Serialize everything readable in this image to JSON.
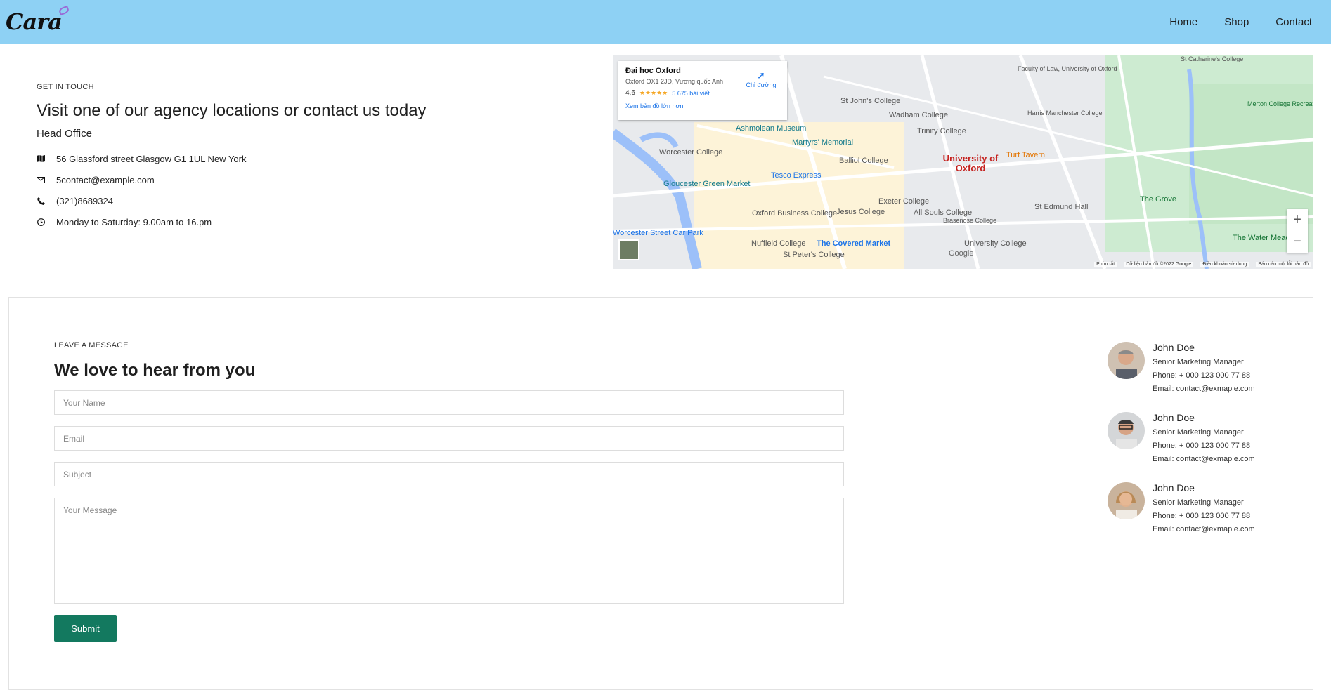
{
  "header": {
    "logo": "Cara",
    "nav": [
      "Home",
      "Shop",
      "Contact"
    ]
  },
  "contact_info": {
    "kicker": "GET IN TOUCH",
    "title": "Visit one of our agency locations or contact us today",
    "office_label": "Head Office",
    "items": [
      {
        "icon": "map-icon",
        "text": "56 Glassford street Glasgow G1 1UL New York"
      },
      {
        "icon": "envelope-icon",
        "text": "5contact@example.com"
      },
      {
        "icon": "phone-icon",
        "text": "(321)8689324"
      },
      {
        "icon": "clock-icon",
        "text": "Monday to Saturday: 9.00am to 16.pm"
      }
    ]
  },
  "map": {
    "card_title": "Đại học Oxford",
    "card_address": "Oxford OX1 2JD, Vương quốc Anh",
    "rating": "4,6",
    "reviews": "5.675 bài viết",
    "larger_map_link": "Xem bản đồ lớn hơn",
    "directions": "Chỉ đường",
    "zoom_in": "+",
    "zoom_out": "−",
    "labels": [
      "Ashmolean Museum",
      "Worcester College",
      "Tesco Express",
      "University of Oxford",
      "Turf Tavern",
      "Balliol College",
      "Oxford Business College",
      "The Covered Market",
      "Exeter College",
      "St John's College",
      "Wadham College",
      "Trinity College",
      "Jesus College",
      "Nuffield College",
      "St Peter's College",
      "University College",
      "All Souls College",
      "The Grove",
      "The Water Meadow",
      "Merton College Recreation Ground",
      "Faculty of Law, University of Oxford",
      "St Catherine's College",
      "Harris Manchester College",
      "Gloucester Green Market",
      "Worcester Street Car Park",
      "Martyrs' Memorial",
      "St Edmund Hall",
      "Brasenose College"
    ],
    "footer": [
      "Phím tắt",
      "Dữ liệu bản đồ ©2022 Google",
      "Điều khoản sử dụng",
      "Báo cáo một lỗi bản đồ"
    ],
    "google": "Google"
  },
  "form": {
    "kicker": "LEAVE A MESSAGE",
    "title": "We love to hear from you",
    "name_placeholder": "Your Name",
    "email_placeholder": "Email",
    "subject_placeholder": "Subject",
    "message_placeholder": "Your Message",
    "submit_label": "Submit"
  },
  "people": [
    {
      "name": "John Doe",
      "role": "Senior Marketing Manager",
      "phone": "Phone: + 000 123 000 77 88",
      "email": "Email: contact@exmaple.com"
    },
    {
      "name": "John Doe",
      "role": "Senior Marketing Manager",
      "phone": "Phone: + 000 123 000 77 88",
      "email": "Email: contact@exmaple.com"
    },
    {
      "name": "John Doe",
      "role": "Senior Marketing Manager",
      "phone": "Phone: + 000 123 000 77 88",
      "email": "Email: contact@exmaple.com"
    }
  ]
}
